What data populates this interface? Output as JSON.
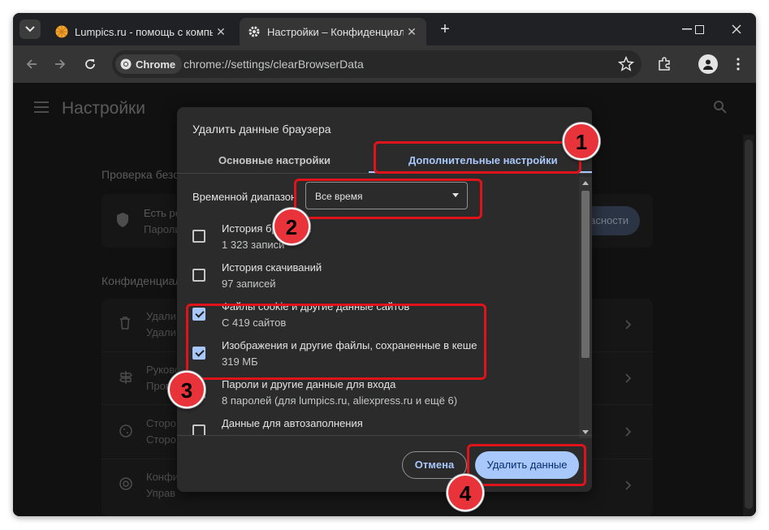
{
  "browser": {
    "tabs": [
      {
        "title": "Lumpics.ru - помощь с компьютером",
        "close": "✕",
        "favicon": "lumpics-orange-circle-icon"
      },
      {
        "title": "Настройки – Конфиденциальность",
        "close": "✕",
        "favicon": "gear-icon"
      }
    ],
    "new_tab": "+",
    "chip_label": "Chrome",
    "url": "chrome://settings/clearBrowserData"
  },
  "settings_bg": {
    "title": "Настройки",
    "safety_heading": "Проверка безопасности",
    "safety_line1": "Есть ре",
    "safety_line2": "Пароли",
    "safety_button": "асности",
    "privacy_heading": "Конфиденциальность и безопасность",
    "rows": [
      {
        "line1": "Удали",
        "line2": "Удали",
        "icon": "trash-icon"
      },
      {
        "line1": "Руково",
        "line2": "Прове",
        "icon": "signpost-icon"
      },
      {
        "line1": "Сторо",
        "line2": "Сторо",
        "icon": "cookie-icon"
      },
      {
        "line1": "Конфи",
        "line2": "Управ",
        "icon": "privacy-target-icon"
      }
    ]
  },
  "dialog": {
    "title": "Удалить данные браузера",
    "tabs": [
      {
        "label": "Основные настройки",
        "active": false
      },
      {
        "label": "Дополнительные настройки",
        "active": true
      }
    ],
    "time_range_label": "Временной диапазон",
    "time_range_value": "Все время",
    "items": [
      {
        "title": "История браузера",
        "subtitle": "1 323 записи",
        "checked": false
      },
      {
        "title": "История скачиваний",
        "subtitle": "97 записей",
        "checked": false
      },
      {
        "title": "Файлы cookie и другие данные сайтов",
        "subtitle": "С 419 сайтов",
        "checked": true
      },
      {
        "title": "Изображения и другие файлы, сохраненные в кеше",
        "subtitle": "319 МБ",
        "checked": true
      },
      {
        "title": "Пароли и другие данные для входа",
        "subtitle": "8 паролей (для lumpics.ru, aliexpress.ru и ещё 6)",
        "checked": true
      },
      {
        "title": "Данные для автозаполнения",
        "subtitle": "",
        "checked": false
      }
    ],
    "cancel_label": "Отмена",
    "delete_label": "Удалить данные"
  },
  "markers": [
    "1",
    "2",
    "3",
    "4"
  ],
  "colors": {
    "highlight": "#e0131b",
    "marker": "#e8333a",
    "accent": "#a8c7fa"
  }
}
